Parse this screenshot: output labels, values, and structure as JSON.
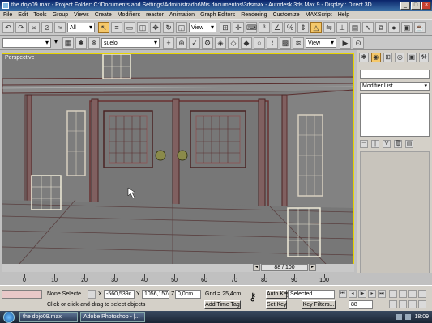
{
  "window": {
    "title": "the dojo09.max  - Project Folder: C:\\Documents and Settings\\Administrador\\Mis documentos\\3dsmax  - Autodesk 3ds Max 9  - Display : Direct 3D",
    "min": "_",
    "max": "□",
    "close": "×"
  },
  "menu": [
    "File",
    "Edit",
    "Tools",
    "Group",
    "Views",
    "Create",
    "Modifiers",
    "reactor",
    "Animation",
    "Graph Editors",
    "Rendering",
    "Customize",
    "MAXScript",
    "Help"
  ],
  "toolbar": {
    "selection_filter": "All",
    "ref_coord": "View",
    "layer": "suelo",
    "view2": "View"
  },
  "viewport": {
    "label": "Perspective"
  },
  "command_panel": {
    "modifier_list": "Modifier List"
  },
  "time_slider": {
    "position": "88 / 100",
    "current": 88,
    "total": 100
  },
  "trackbar": {
    "ticks": [
      "0",
      "10",
      "20",
      "30",
      "40",
      "50",
      "60",
      "70",
      "80",
      "90",
      "100"
    ]
  },
  "status": {
    "selection": "None Selecte",
    "x": "-560,539c",
    "y": "1056,157c",
    "z": "0,0cm",
    "grid": "Grid = 25,4cm",
    "prompt": "Click or click-and-drag to select objects",
    "add_time_tag": "Add Time Tag",
    "auto_key": "Auto Key",
    "set_key": "Set Key",
    "key_mode": "Selected",
    "key_filters": "Key Filters...",
    "frame": "88"
  },
  "taskbar": {
    "items": [
      "the dojo09.max",
      "Adobe Photoshop - [..."
    ],
    "clock": "18:09"
  }
}
